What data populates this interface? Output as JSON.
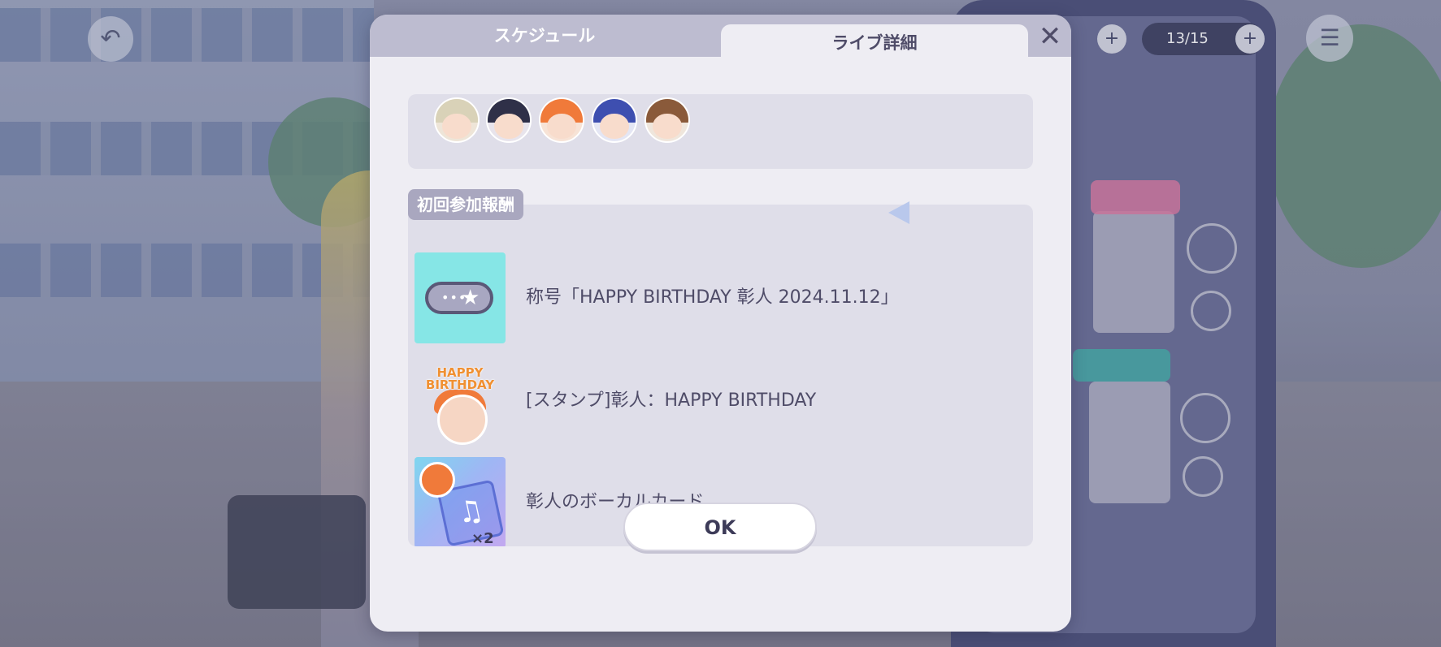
{
  "tabs": [
    {
      "label": "スケジュール",
      "active": false
    },
    {
      "label": "ライブ詳細",
      "active": true
    }
  ],
  "close_icon": "close-icon",
  "members": [
    {
      "name": "member-1",
      "hair": "#d9d2b8"
    },
    {
      "name": "member-2",
      "hair": "#2f3048"
    },
    {
      "name": "member-3",
      "hair": "#f07a3a"
    },
    {
      "name": "member-4",
      "hair": "#3e4fb0"
    },
    {
      "name": "member-5",
      "hair": "#8a5a3a"
    }
  ],
  "rewards_label": "初回参加報酬",
  "rewards": [
    {
      "text": "称号「HAPPY BIRTHDAY 彰人 2024.11.12」",
      "icon": "title-badge-icon"
    },
    {
      "text": "[スタンプ]彰人：HAPPY BIRTHDAY",
      "icon": "stamp-icon",
      "stamp_text": "HAPPY BIRTHDAY"
    },
    {
      "text": "彰人のボーカルカード",
      "icon": "vocal-card-icon",
      "count": "×2"
    }
  ],
  "ok_button": "OK",
  "background": {
    "status_text": "13/15"
  }
}
